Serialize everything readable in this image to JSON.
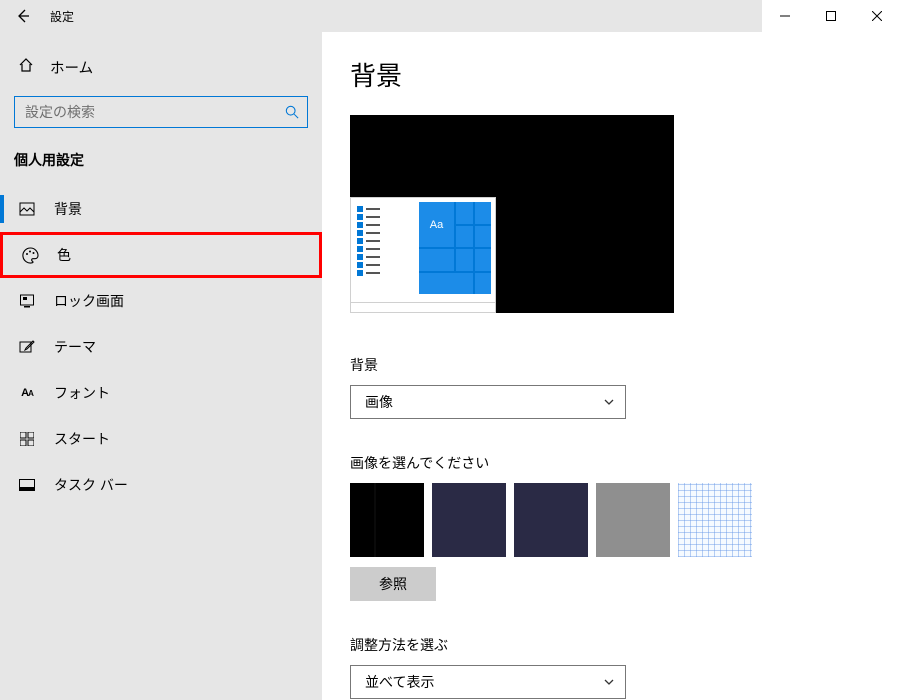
{
  "window": {
    "title": "設定"
  },
  "sidebar": {
    "home": "ホーム",
    "search_placeholder": "設定の検索",
    "section": "個人用設定",
    "items": [
      {
        "key": "background",
        "label": "背景"
      },
      {
        "key": "colors",
        "label": "色"
      },
      {
        "key": "lockscreen",
        "label": "ロック画面"
      },
      {
        "key": "themes",
        "label": "テーマ"
      },
      {
        "key": "fonts",
        "label": "フォント"
      },
      {
        "key": "start",
        "label": "スタート"
      },
      {
        "key": "taskbar",
        "label": "タスク バー"
      }
    ]
  },
  "page": {
    "title": "背景",
    "preview_sample_text": "Aa",
    "bg_label": "背景",
    "bg_value": "画像",
    "choose_label": "画像を選んでください",
    "browse": "参照",
    "fit_label": "調整方法を選ぶ",
    "fit_value": "並べて表示"
  }
}
